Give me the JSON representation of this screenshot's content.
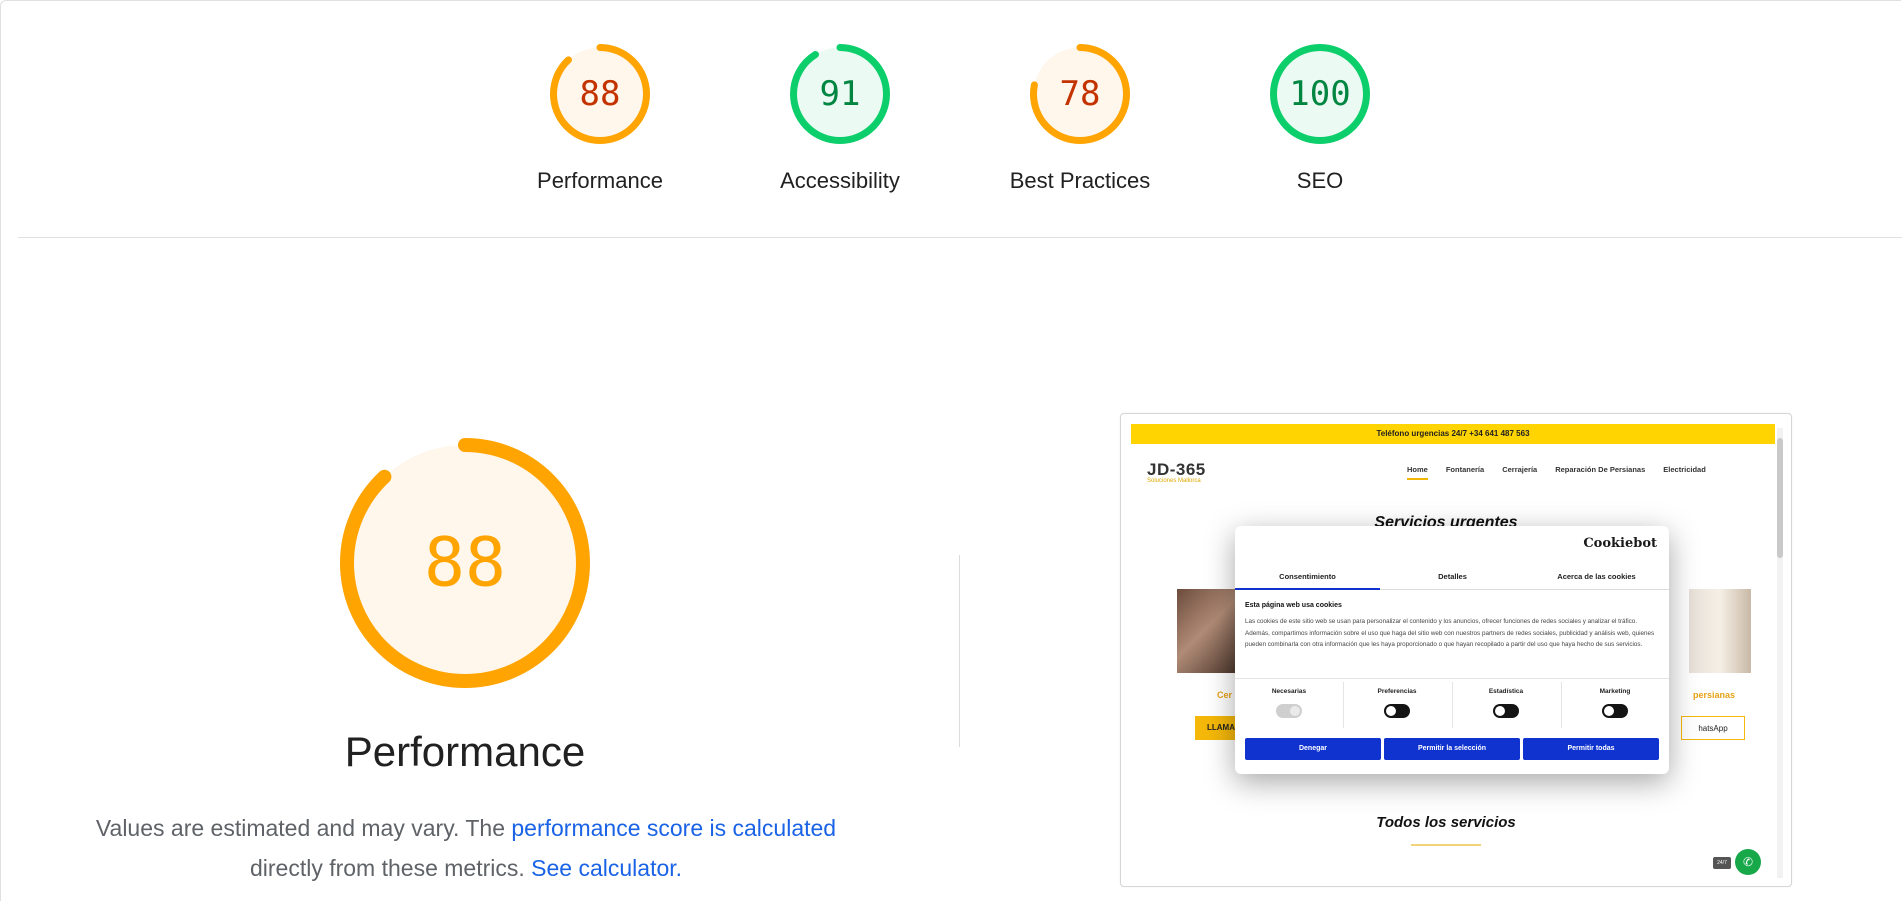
{
  "gauges": [
    {
      "label": "Performance",
      "score": "88",
      "value": 88,
      "color": "#ffa400",
      "text_color": "#c33300",
      "fill": "#fff6ec"
    },
    {
      "label": "Accessibility",
      "score": "91",
      "value": 91,
      "color": "#0cce6b",
      "text_color": "#018642",
      "fill": "#ebfaf2"
    },
    {
      "label": "Best Practices",
      "score": "78",
      "value": 78,
      "color": "#ffa400",
      "text_color": "#c33300",
      "fill": "#fff6ec"
    },
    {
      "label": "SEO",
      "score": "100",
      "value": 100,
      "color": "#0cce6b",
      "text_color": "#018642",
      "fill": "#ebfaf2"
    }
  ],
  "performance": {
    "score": "88",
    "value": 88,
    "title": "Performance",
    "color": "#ffa400",
    "desc_prefix": "Values are estimated and may vary. The ",
    "link_calc": "performance score is calculated",
    "desc_middle": " directly from these metrics. ",
    "link_calculator": "See calculator."
  },
  "screenshot": {
    "topbar": "Teléfono urgencias 24/7 +34 641 487 563",
    "logo": "JD-365",
    "logo_sub": "Soluciones Mallorca",
    "nav": [
      "Home",
      "Fontanería",
      "Cerrajería",
      "Reparación De Persianas",
      "Electricidad"
    ],
    "heading1": "Servicios urgentes",
    "heading2": "Todos los servicios",
    "left_orange": "Cer",
    "right_orange": "persianas",
    "left_button": "LLAMA",
    "right_button": "hatsApp",
    "badge": "24/7",
    "cookie": {
      "brand": "Cookiebot",
      "tabs": [
        "Consentimiento",
        "Detalles",
        "Acerca de las cookies"
      ],
      "heading": "Esta página web usa cookies",
      "body": "Las cookies de este sitio web se usan para personalizar el contenido y los anuncios, ofrecer funciones de redes sociales y analizar el tráfico. Además, compartimos información sobre el uso que haga del sitio web con nuestros partners de redes sociales, publicidad y análisis web, quienes pueden combinarla con otra información que les haya proporcionado o que hayan recopilado a partir del uso que haya hecho de sus servicios.",
      "options": [
        "Necesarias",
        "Preferencias",
        "Estadística",
        "Marketing"
      ],
      "buttons": [
        "Denegar",
        "Permitir la selección",
        "Permitir todas"
      ]
    }
  }
}
